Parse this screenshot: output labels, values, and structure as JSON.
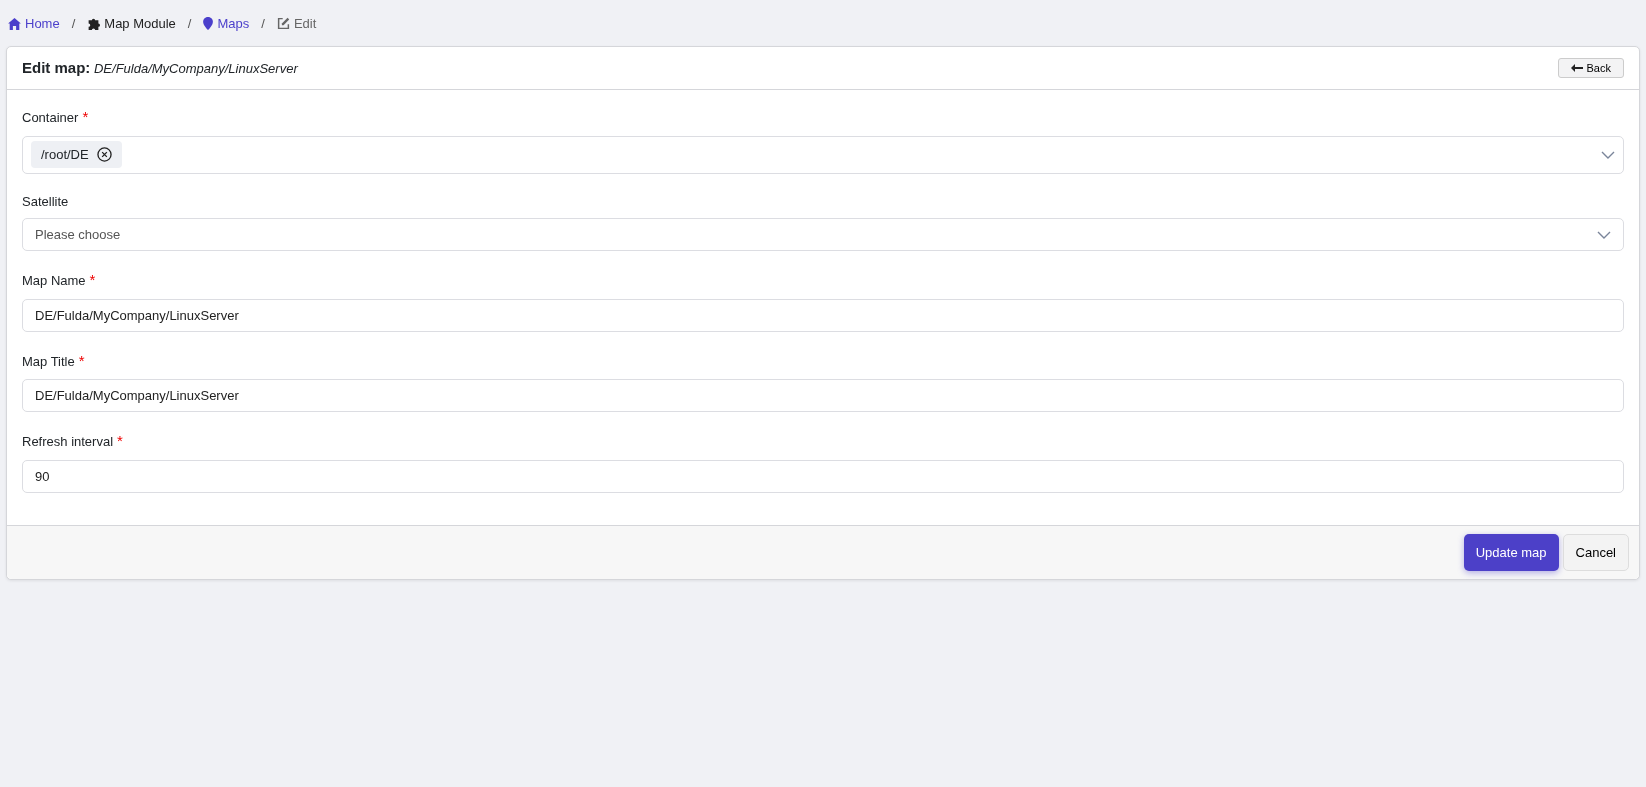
{
  "breadcrumb": [
    {
      "label": "Home",
      "kind": "link"
    },
    {
      "label": "Map Module",
      "kind": "text"
    },
    {
      "label": "Maps",
      "kind": "link"
    },
    {
      "label": "Edit",
      "kind": "active"
    }
  ],
  "breadcrumb_separators": [
    "/",
    "/",
    "/"
  ],
  "card": {
    "title": "Edit map:",
    "subtitle": "DE/Fulda/MyCompany/LinuxServer",
    "back_button": "Back"
  },
  "fields": [
    {
      "label": "Container",
      "required": true,
      "kind": "multiselect",
      "tags": [
        "/root/DE"
      ]
    },
    {
      "label": "Satellite",
      "required": false,
      "kind": "select",
      "placeholder": "Please choose"
    },
    {
      "label": "Map Name",
      "required": true,
      "kind": "input",
      "value": "DE/Fulda/MyCompany/LinuxServer"
    },
    {
      "label": "Map Title",
      "required": true,
      "kind": "input",
      "value": "DE/Fulda/MyCompany/LinuxServer"
    },
    {
      "label": "Refresh interval",
      "required": true,
      "kind": "input",
      "value": "90"
    }
  ],
  "required_mark": "*",
  "footer": {
    "primary_button": "Update map",
    "cancel_button": "Cancel"
  }
}
